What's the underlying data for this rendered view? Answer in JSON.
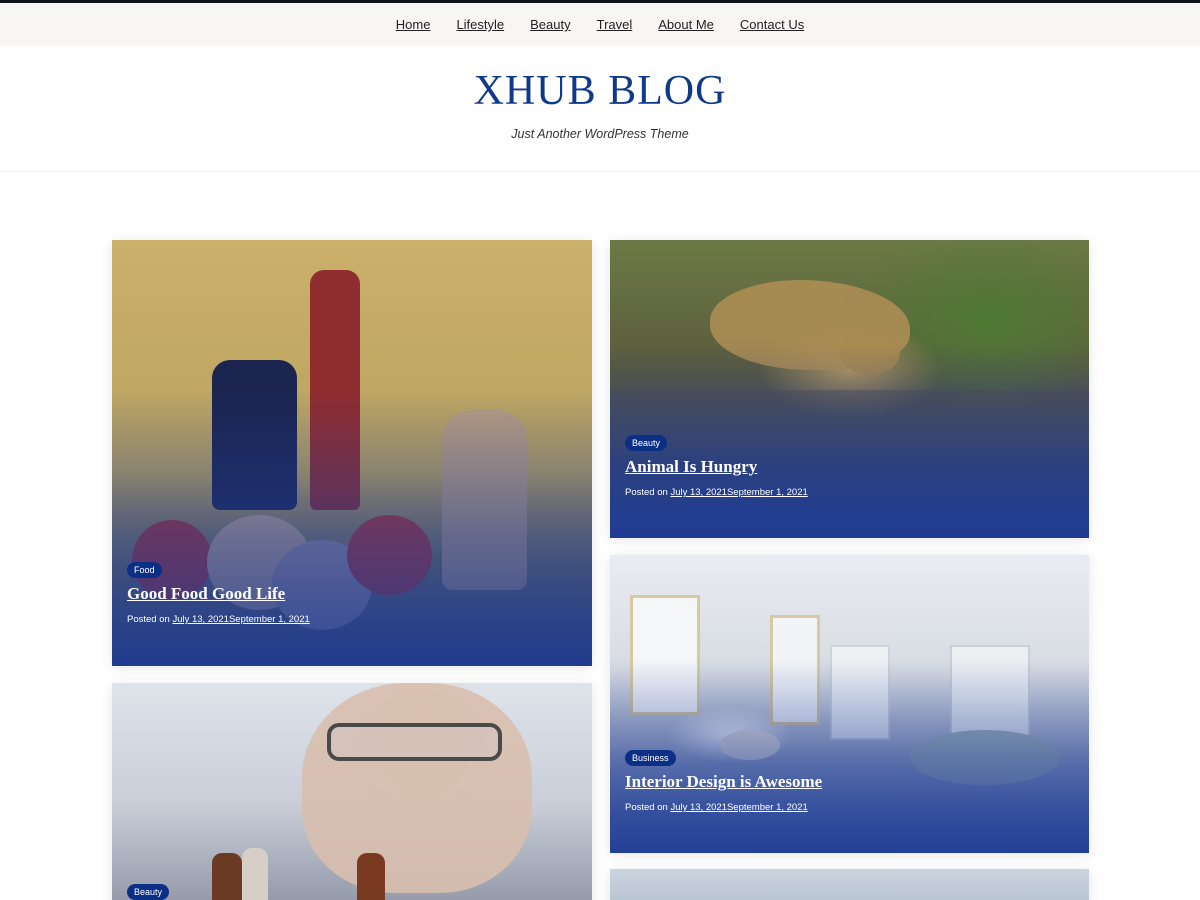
{
  "nav": {
    "items": [
      {
        "label": "Home"
      },
      {
        "label": "Lifestyle"
      },
      {
        "label": "Beauty"
      },
      {
        "label": "Travel"
      },
      {
        "label": "About Me"
      },
      {
        "label": "Contact Us"
      }
    ]
  },
  "site": {
    "title": "XHUB BLOG",
    "tagline": "Just Another WordPress Theme"
  },
  "posts": [
    {
      "category": "Food",
      "title": "Good Food Good Life",
      "posted_on_label": "Posted on",
      "published": "July 13, 2021",
      "updated": "September 1, 2021",
      "image": "food-still-life-image"
    },
    {
      "category": "Beauty",
      "title": "Animal Is Hungry",
      "posted_on_label": "Posted on",
      "published": "July 13, 2021",
      "updated": "September 1, 2021",
      "image": "leopard-image"
    },
    {
      "category": "Business",
      "title": "Interior Design is Awesome",
      "posted_on_label": "Posted on",
      "published": "July 13, 2021",
      "updated": "September 1, 2021",
      "image": "living-room-image"
    },
    {
      "category": "Beauty",
      "image": "chess-player-image"
    },
    {
      "image": "sky-image"
    }
  ],
  "colors": {
    "brand": "#0f3a8c",
    "badge": "#0c2f86",
    "nav_bg": "#f7f6f3"
  }
}
